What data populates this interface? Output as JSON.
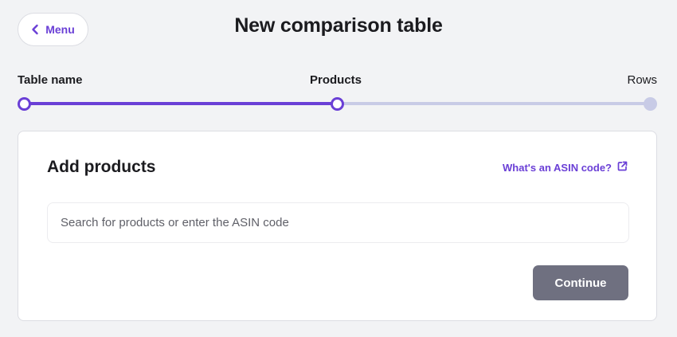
{
  "header": {
    "menu_label": "Menu",
    "back_icon": "chevron-left-icon",
    "title": "New comparison table"
  },
  "stepper": {
    "steps": [
      {
        "label": "Table name",
        "state": "completed"
      },
      {
        "label": "Products",
        "state": "current"
      },
      {
        "label": "Rows",
        "state": "upcoming"
      }
    ],
    "progress": 0.5
  },
  "card": {
    "title": "Add products",
    "help_link": "What's an ASIN code?",
    "help_icon": "external-link-icon",
    "search": {
      "value": "",
      "placeholder": "Search for products or enter the ASIN code"
    },
    "continue_label": "Continue"
  },
  "colors": {
    "accent": "#6a3fd6",
    "track": "#c8cbe6",
    "button_disabled": "#6f7080",
    "background": "#f2f3f5"
  }
}
